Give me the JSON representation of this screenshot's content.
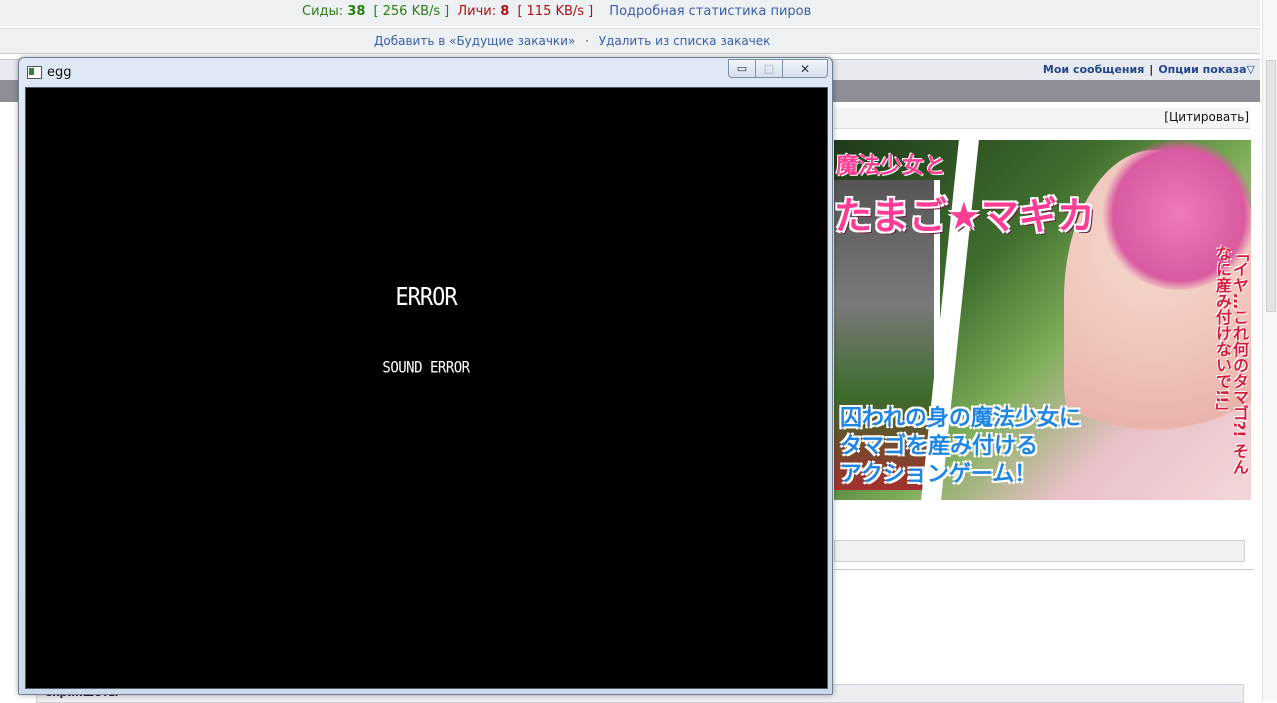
{
  "browser_page": {
    "stats": {
      "seeds_label": "Сиды:",
      "seeds_count": "38",
      "seeds_speed": "256 KB/s",
      "leechers_label": "Личи:",
      "leechers_count": "8",
      "leechers_speed": "115 KB/s",
      "peer_stats_link": "Подробная статистика пиров"
    },
    "actions": {
      "add_future": "Добавить в «Будущие закачки»",
      "separator": "·",
      "remove": "Удалить из списка закачек"
    },
    "header_links": {
      "my_messages": "Мои сообщения",
      "pipe": "|",
      "display_options": "Опции показа"
    },
    "quote_button": "[Цитировать]",
    "banner": {
      "top_text": "魔法少女と",
      "title_text": "たまご★マギカ",
      "lines": [
        "囚われの身の魔法少女に",
        "タマゴを産み付ける",
        "アクションゲーム！"
      ],
      "vertical_text": "「イヤ…これ何のタマゴ?! そんなに産み付けないで!!」"
    },
    "bottom_label": "Скриншоты"
  },
  "window": {
    "title": "egg",
    "minimize_glyph": "▭",
    "maximize_glyph": "□",
    "close_glyph": "✕",
    "error_title": "ERROR",
    "error_message": "SOUND ERROR"
  },
  "colors": {
    "seeds": "#2a7d13",
    "leechers": "#b01010",
    "link": "#3a5ea6",
    "game_background": "#000000"
  }
}
